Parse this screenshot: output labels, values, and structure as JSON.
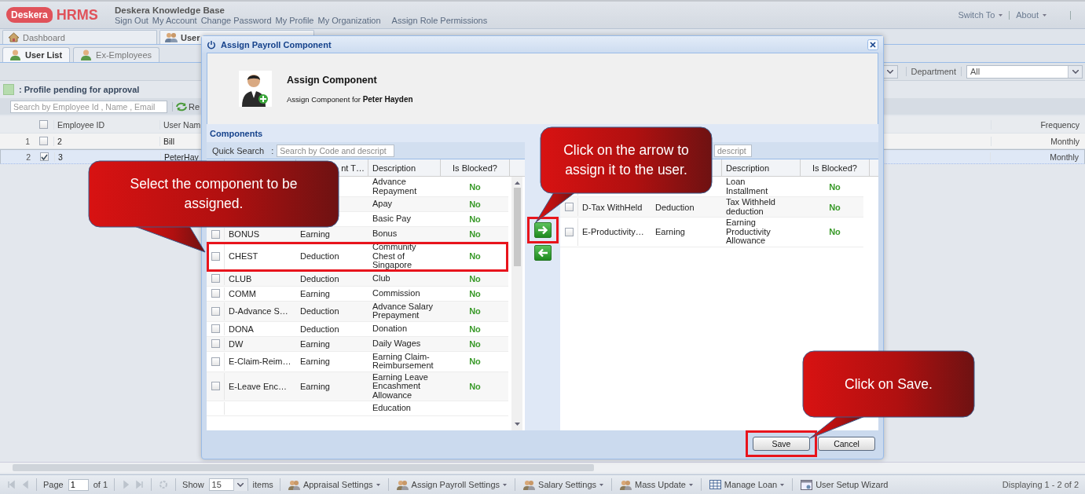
{
  "header": {
    "brand": "Deskera",
    "product": "HRMS",
    "title": "Deskera Knowledge Base",
    "links": [
      "Sign Out",
      "My Account",
      "Change Password",
      "My Profile",
      "My Organization",
      "Assign Role Permissions"
    ],
    "menus": [
      "Switch To",
      "About"
    ]
  },
  "main_tabs": [
    {
      "label": "Dashboard",
      "kind": "home",
      "selected": false
    },
    {
      "label": "User",
      "kind": "users",
      "selected": true
    }
  ],
  "sub_tabs": [
    {
      "label": "User List",
      "selected": true
    },
    {
      "label": "Ex-Employees",
      "selected": false
    }
  ],
  "filter": {
    "department_label": "Department",
    "department_value": "All"
  },
  "legend": ": Profile pending for approval",
  "search": {
    "placeholder": "Search by Employee Id , Name , Email",
    "reset_label": "Re"
  },
  "table": {
    "all_checked": false,
    "columns": [
      "Employee ID",
      "User Nam",
      "Frequency"
    ],
    "rows": [
      {
        "number": "1",
        "checked": false,
        "selected": false,
        "employee_id": "2",
        "user_name": "Bill",
        "frequency": "Monthly"
      },
      {
        "number": "2",
        "checked": true,
        "selected": true,
        "employee_id": "3",
        "user_name": "PeterHay",
        "frequency": "Monthly"
      }
    ]
  },
  "dialog": {
    "title": "Assign Payroll Component",
    "heading": "Assign Component",
    "subheading": "Assign Component for **Peter Hayden**",
    "available": {
      "title": "Components",
      "search_label": "Quick Search   :",
      "search_placeholder": "Search by Code and descript",
      "headers": {
        "type": "nt T…",
        "description": "Description",
        "blocked": "Is Blocked?"
      },
      "rows": [
        {
          "description": "Advance Repayment",
          "blocked": "No",
          "highlighted": false
        },
        {
          "description": "Apay",
          "blocked": "No",
          "highlighted": false
        },
        {
          "description": "Basic Pay",
          "blocked": "No",
          "highlighted": false
        },
        {
          "checked": false,
          "code": "BONUS",
          "type": "Earning",
          "description": "Bonus",
          "blocked": "No",
          "highlighted": false
        },
        {
          "checked": false,
          "code": "CHEST",
          "type": "Deduction",
          "description": "Community Chest of Singapore",
          "blocked": "No",
          "highlighted": true
        },
        {
          "checked": false,
          "code": "CLUB",
          "type": "Deduction",
          "description": "Club",
          "blocked": "No",
          "highlighted": false
        },
        {
          "checked": false,
          "code": "COMM",
          "type": "Earning",
          "description": "Commission",
          "blocked": "No",
          "highlighted": false
        },
        {
          "checked": false,
          "code": "D-Advance S…",
          "type": "Deduction",
          "description": "Advance Salary Prepayment",
          "blocked": "No",
          "highlighted": false
        },
        {
          "checked": false,
          "code": "DONA",
          "type": "Deduction",
          "description": "Donation",
          "blocked": "No",
          "highlighted": false
        },
        {
          "checked": false,
          "code": "DW",
          "type": "Earning",
          "description": "Daily Wages",
          "blocked": "No",
          "highlighted": false
        },
        {
          "checked": false,
          "code": "E-Claim-Reim…",
          "type": "Earning",
          "description": "Earning Claim-Reimbursement",
          "blocked": "No",
          "highlighted": false
        },
        {
          "checked": false,
          "code": "E-Leave Enc…",
          "type": "Earning",
          "description": "Earning Leave Encashment Allowance",
          "blocked": "No",
          "highlighted": false
        },
        {
          "description": "Education",
          "highlighted": false
        }
      ]
    },
    "assigned": {
      "search_placeholder": "descript",
      "headers": {
        "description": "Description",
        "blocked": "Is Blocked?"
      },
      "rows": [
        {
          "description": "Loan Installment",
          "blocked": "No",
          "highlighted": false
        },
        {
          "checked": false,
          "code": "D-Tax WithHeld",
          "type": "Deduction",
          "description": "Tax Withheld deduction",
          "blocked": "No",
          "highlighted": false
        },
        {
          "checked": false,
          "code": "E-Productivity…",
          "type": "Earning",
          "description": "Earning Productivity Allowance",
          "blocked": "No",
          "highlighted": false
        }
      ]
    },
    "move_buttons": [
      {
        "kind": "right",
        "highlighted": true
      },
      {
        "kind": "left",
        "highlighted": false
      }
    ],
    "buttons": [
      {
        "label": "Save",
        "highlighted": true
      },
      {
        "label": "Cancel",
        "highlighted": false
      }
    ]
  },
  "callouts": [
    {
      "kind": "select",
      "text": "Select the component to be assigned."
    },
    {
      "kind": "arrow",
      "text": "Click on the arrow to assign it to the user."
    },
    {
      "kind": "save",
      "text": "Click on Save."
    }
  ],
  "footer": {
    "nav_back": [
      {
        "kind": "first",
        "disabled": true
      },
      {
        "kind": "prev",
        "disabled": true
      }
    ],
    "page_label": "Page",
    "page_value": "1",
    "of_label": "of 1",
    "nav_forward": [
      {
        "kind": "next",
        "disabled": true
      },
      {
        "kind": "last",
        "disabled": true
      }
    ],
    "show_label": "Show",
    "page_size": "15",
    "items_label": "items",
    "buttons": [
      {
        "label": "Appraisal Settings",
        "kind": "people",
        "has_menu": true
      },
      {
        "label": "Assign Payroll Settings",
        "kind": "people",
        "has_menu": true
      },
      {
        "label": "Salary Settings",
        "kind": "people",
        "has_menu": true
      },
      {
        "label": "Mass Update",
        "kind": "people",
        "has_menu": true
      },
      {
        "label": "Manage Loan",
        "kind": "grid",
        "has_menu": true
      },
      {
        "label": "User Setup Wizard",
        "kind": "window",
        "has_menu": false
      }
    ],
    "summary": "Displaying 1 - 2 of 2"
  }
}
